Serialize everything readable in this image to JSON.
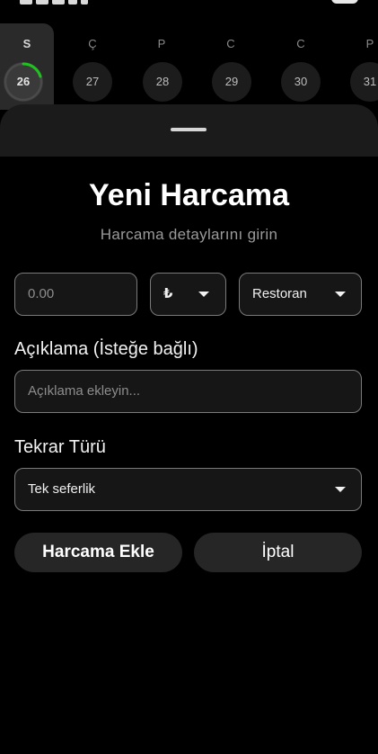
{
  "calendar": {
    "days": [
      {
        "letter": "S",
        "number": "26",
        "selected": true
      },
      {
        "letter": "Ç",
        "number": "27",
        "selected": false
      },
      {
        "letter": "P",
        "number": "28",
        "selected": false
      },
      {
        "letter": "C",
        "number": "29",
        "selected": false
      },
      {
        "letter": "C",
        "number": "30",
        "selected": false
      },
      {
        "letter": "P",
        "number": "31",
        "selected": false
      }
    ],
    "progress_color": "#1ec31e"
  },
  "form": {
    "title": "Yeni Harcama",
    "subtitle": "Harcama detaylarını girin",
    "amount_placeholder": "0.00",
    "currency_value": "₺",
    "category_value": "Restoran",
    "description_label": "Açıklama (İsteğe bağlı)",
    "description_placeholder": "Açıklama ekleyin...",
    "repeat_label": "Tekrar Türü",
    "repeat_value": "Tek seferlik"
  },
  "actions": {
    "add_label": "Harcama Ekle",
    "cancel_label": "İptal"
  }
}
